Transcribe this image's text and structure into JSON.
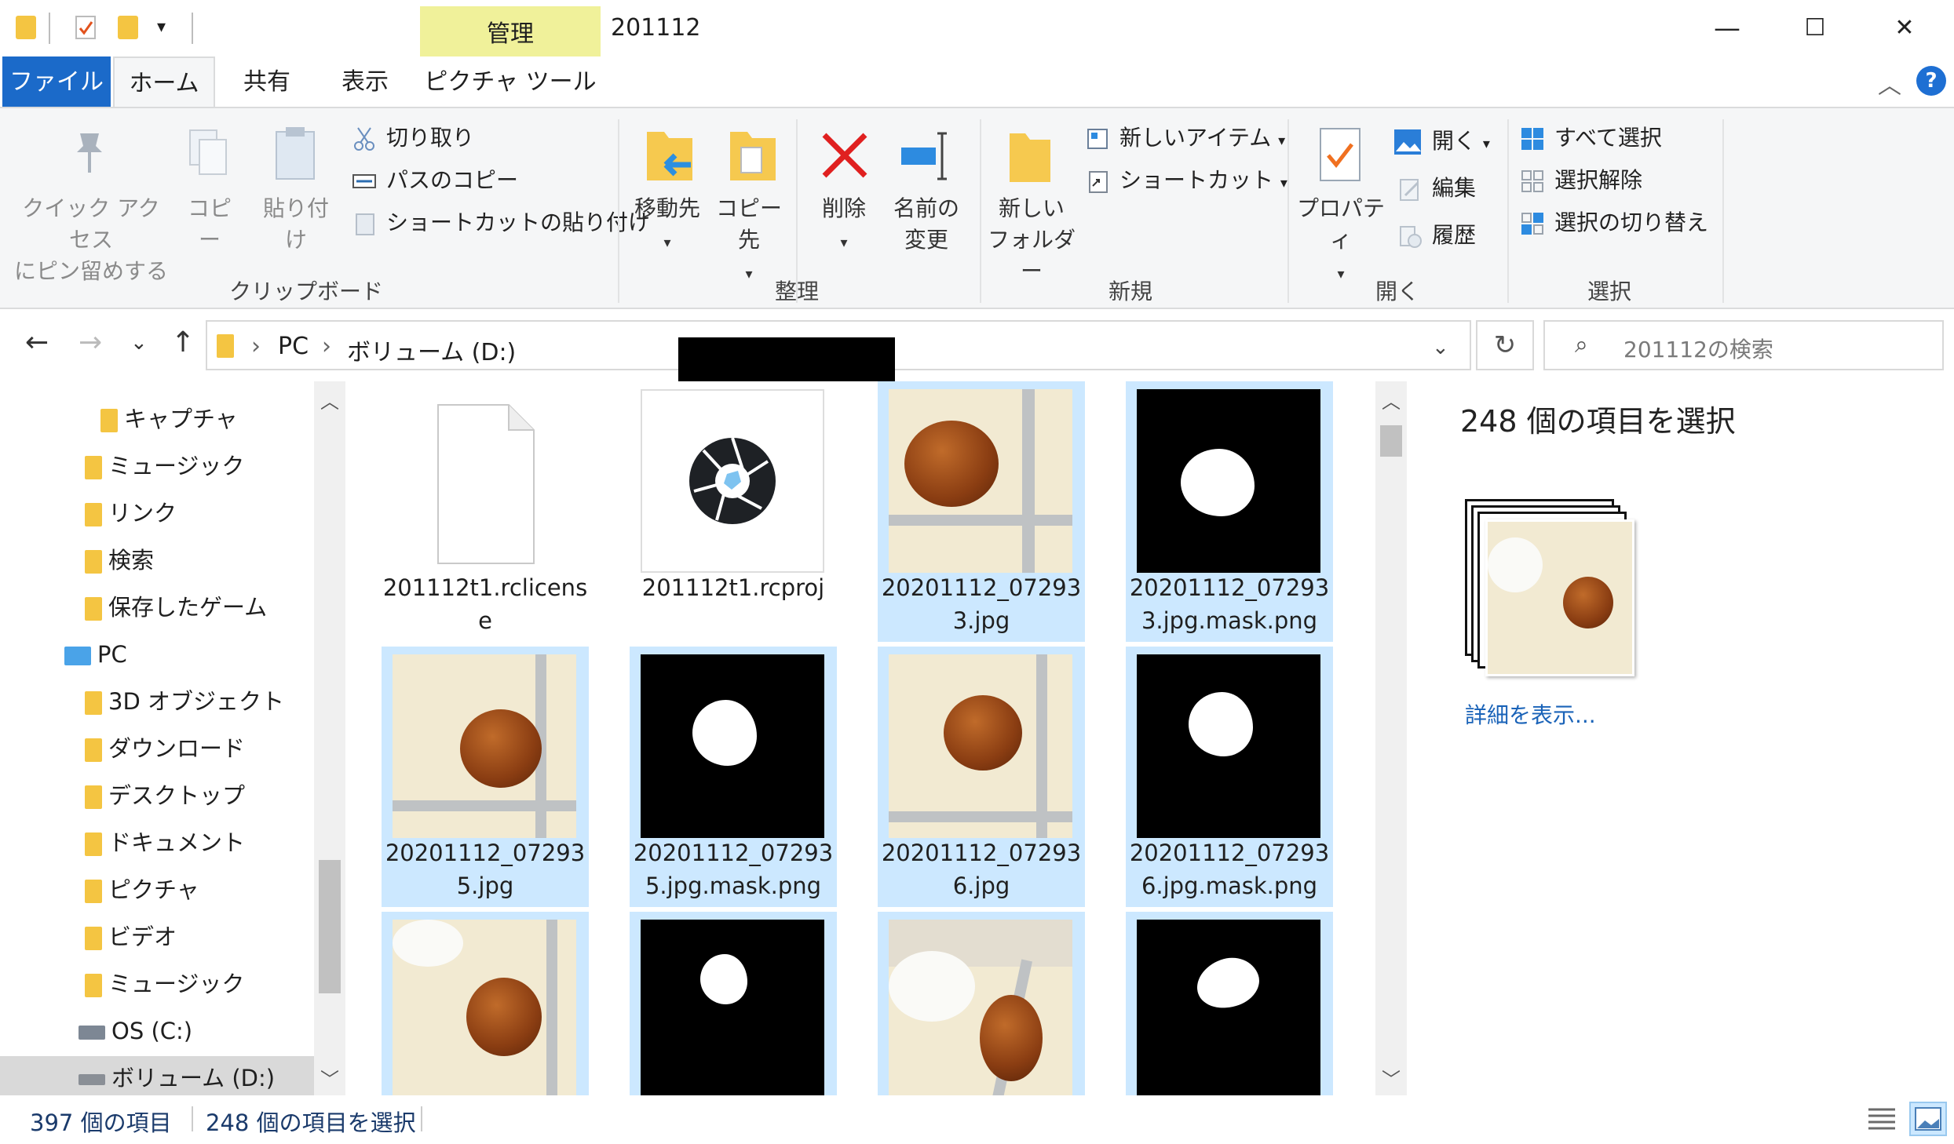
{
  "window": {
    "title": "201112",
    "manage_tab": "管理",
    "minimize": "—",
    "maximize": "☐",
    "close": "✕"
  },
  "tabs": [
    {
      "label": "ファイル"
    },
    {
      "label": "ホーム"
    },
    {
      "label": "共有"
    },
    {
      "label": "表示"
    },
    {
      "label": "ピクチャ ツール"
    }
  ],
  "help": "?",
  "ribbon": {
    "clipboard": {
      "pin": "クイック アクセス\nにピン留めする",
      "copy": "コピー",
      "paste": "貼り付け",
      "cut": "切り取り",
      "copy_path": "パスのコピー",
      "paste_shortcut": "ショートカットの貼り付け",
      "label": "クリップボード"
    },
    "organize": {
      "move_to": "移動先",
      "copy_to": "コピー先",
      "delete": "削除",
      "rename": "名前の\n変更",
      "label": "整理"
    },
    "new": {
      "new_folder": "新しい\nフォルダー",
      "new_item": "新しいアイテム",
      "shortcut": "ショートカット",
      "label": "新規"
    },
    "open": {
      "properties": "プロパティ",
      "open": "開く",
      "edit": "編集",
      "history": "履歴",
      "label": "開く"
    },
    "select": {
      "select_all": "すべて選択",
      "select_none": "選択解除",
      "invert": "選択の切り替え",
      "label": "選択"
    }
  },
  "address": {
    "crumbs": [
      "PC",
      "ボリューム (D:)"
    ],
    "search_placeholder": "201112の検索"
  },
  "nav": {
    "items": [
      {
        "label": "キャプチャ",
        "indent": 2
      },
      {
        "label": "ミュージック",
        "indent": 1
      },
      {
        "label": "リンク",
        "indent": 1
      },
      {
        "label": "検索",
        "indent": 1
      },
      {
        "label": "保存したゲーム",
        "indent": 1
      },
      {
        "label": "PC",
        "indent": 0
      },
      {
        "label": "3D オブジェクト",
        "indent": 1
      },
      {
        "label": "ダウンロード",
        "indent": 1
      },
      {
        "label": "デスクトップ",
        "indent": 1
      },
      {
        "label": "ドキュメント",
        "indent": 1
      },
      {
        "label": "ピクチャ",
        "indent": 1
      },
      {
        "label": "ビデオ",
        "indent": 1
      },
      {
        "label": "ミュージック",
        "indent": 1
      },
      {
        "label": "OS (C:)",
        "indent": 1
      },
      {
        "label": "ボリューム (D:)",
        "indent": 1
      }
    ]
  },
  "files": [
    {
      "name": "201112t1.rclicense",
      "kind": "doc",
      "selected": false
    },
    {
      "name": "201112t1.rcproj",
      "kind": "app",
      "selected": false
    },
    {
      "name": "20201112_072933.jpg",
      "kind": "photo",
      "selected": true
    },
    {
      "name": "20201112_072933.jpg.mask.png",
      "kind": "mask",
      "selected": true
    },
    {
      "name": "20201112_072935.jpg",
      "kind": "photo",
      "selected": true
    },
    {
      "name": "20201112_072935.jpg.mask.png",
      "kind": "mask",
      "selected": true
    },
    {
      "name": "20201112_072936.jpg",
      "kind": "photo",
      "selected": true
    },
    {
      "name": "20201112_072936.jpg.mask.png",
      "kind": "mask",
      "selected": true
    },
    {
      "name": "",
      "kind": "photo",
      "selected": true
    },
    {
      "name": "",
      "kind": "mask",
      "selected": true
    },
    {
      "name": "",
      "kind": "photo",
      "selected": true
    },
    {
      "name": "",
      "kind": "mask",
      "selected": true
    }
  ],
  "preview": {
    "title": "248 個の項目を選択",
    "details_link": "詳細を表示..."
  },
  "status": {
    "item_count": "397 個の項目",
    "selected_count": "248 個の項目を選択"
  }
}
